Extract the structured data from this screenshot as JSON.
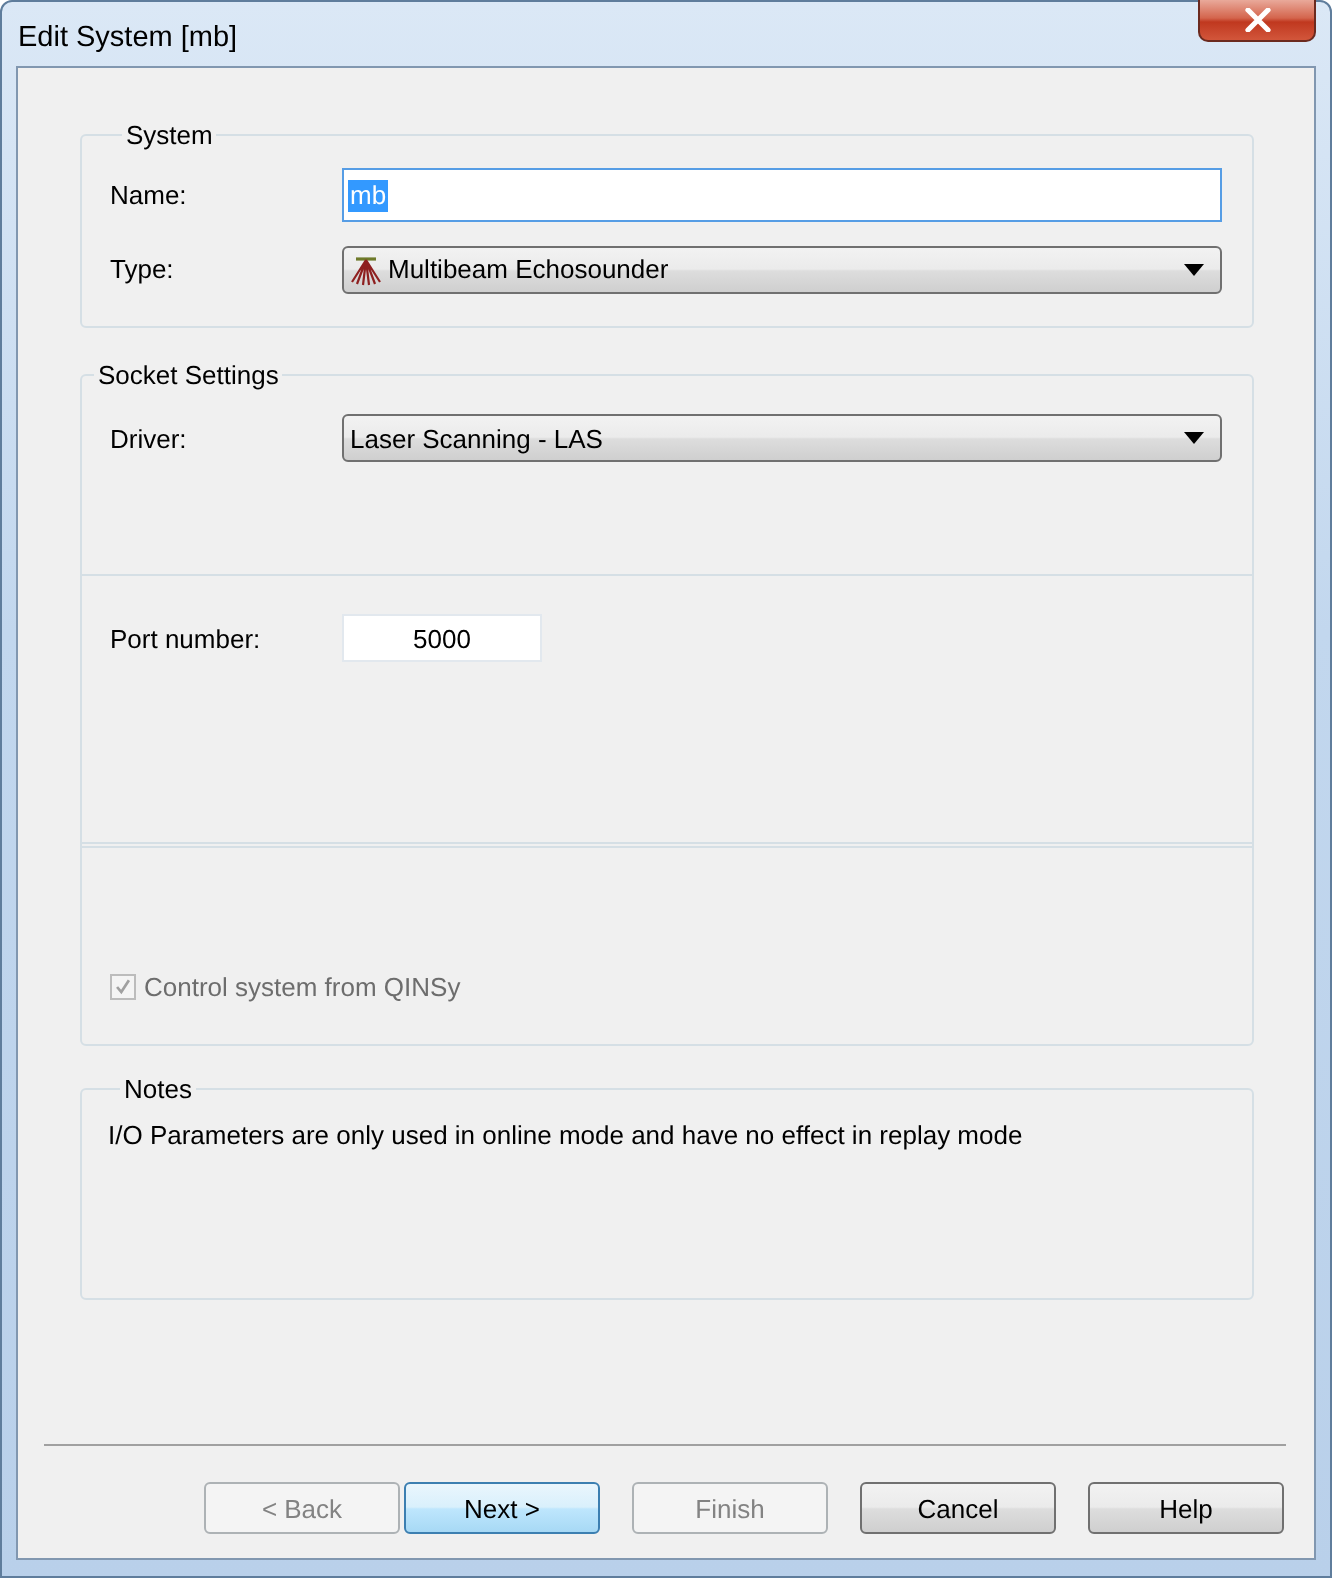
{
  "window": {
    "title": "Edit System [mb]"
  },
  "system": {
    "title": "System",
    "name": {
      "label": "Name:",
      "value": "mb",
      "focused": true,
      "text_selected": true
    },
    "type": {
      "label": "Type:",
      "value": "Multibeam Echosounder"
    }
  },
  "socket_settings": {
    "title": "Socket Settings",
    "driver": {
      "label": "Driver:",
      "value": "Laser Scanning - LAS"
    },
    "port_number": {
      "label": "Port number:",
      "value": "5000"
    },
    "control_checkbox": {
      "label": "Control system from QINSy",
      "checked": true,
      "disabled": true
    }
  },
  "notes": {
    "title": "Notes",
    "text": "I/O Parameters are only used in online mode and have no effect in replay mode"
  },
  "buttons": [
    {
      "label": "< Back",
      "disabled": true,
      "default": false
    },
    {
      "label": "Next >",
      "disabled": false,
      "default": true
    },
    {
      "label": "Finish",
      "disabled": true,
      "default": false
    },
    {
      "label": "Cancel",
      "disabled": false,
      "default": false
    },
    {
      "label": "Help",
      "disabled": false,
      "default": false
    }
  ]
}
